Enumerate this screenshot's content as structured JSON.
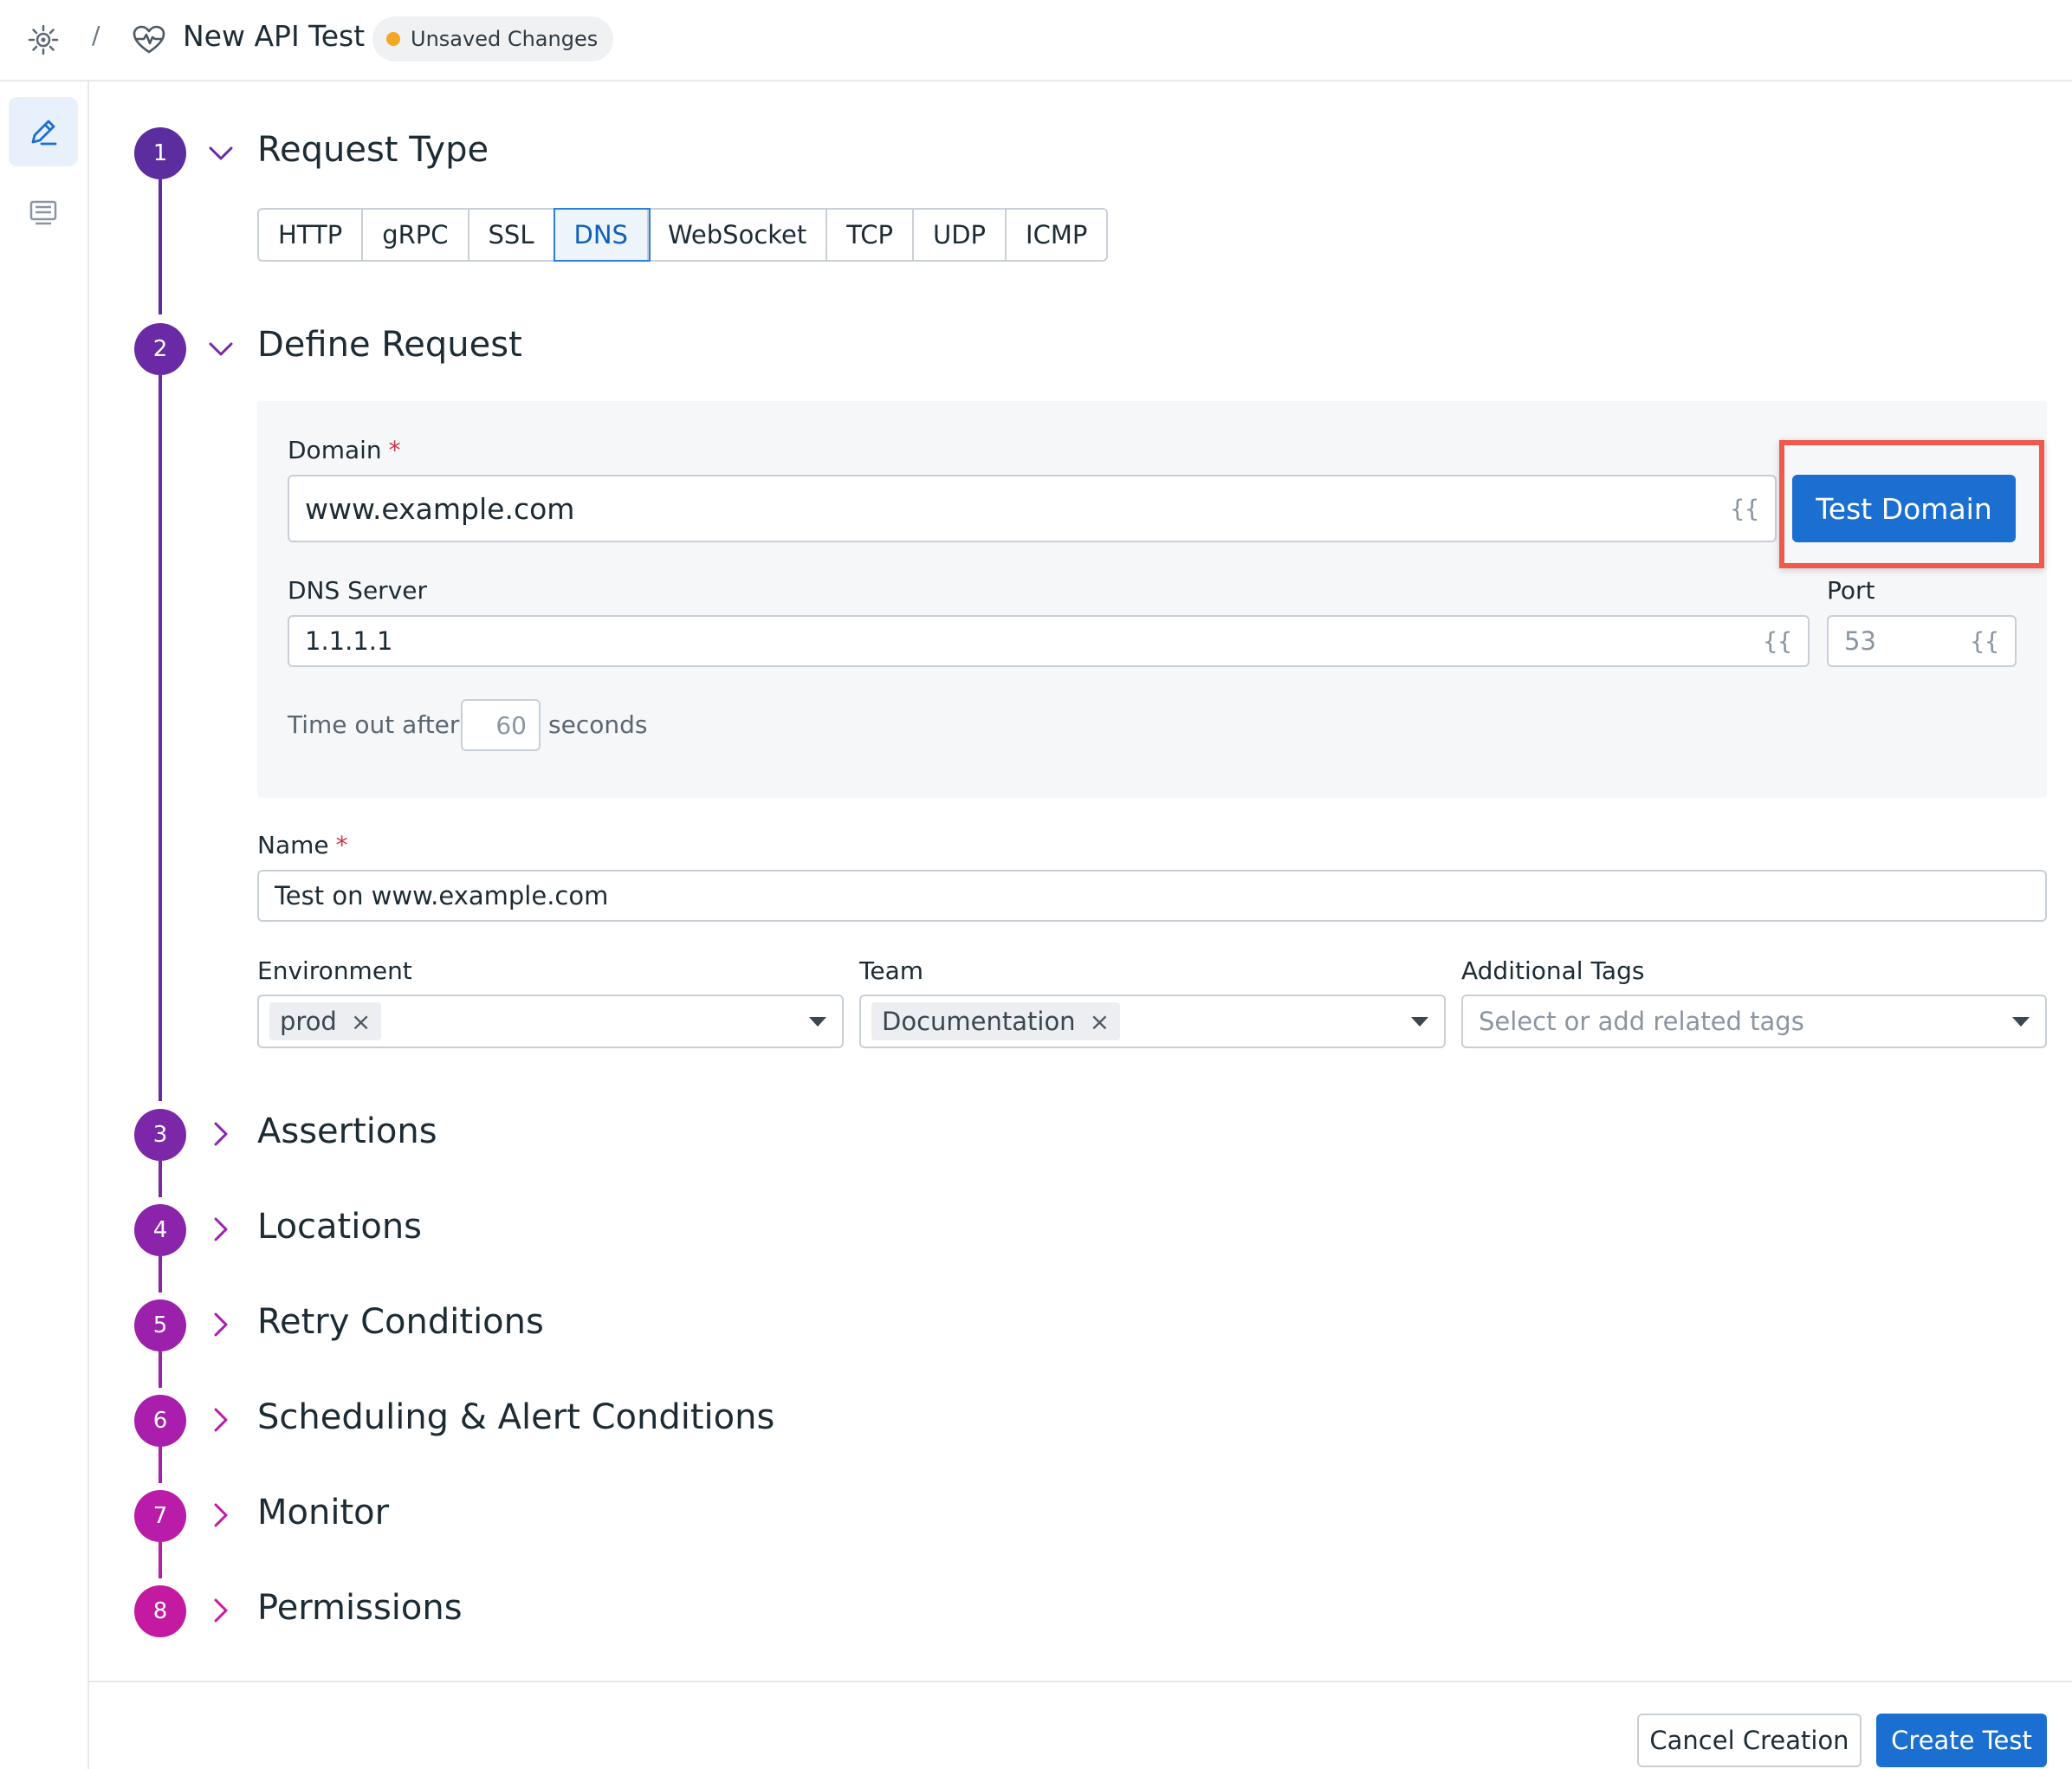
{
  "header": {
    "logo_icon": "datadog-logo-icon",
    "separator": "/",
    "test_icon": "heartbeat-icon",
    "title": "New API Test",
    "status_badge": "Unsaved Changes",
    "status_color": "#f5a623"
  },
  "rail": {
    "items": [
      {
        "icon": "pencil-icon",
        "active": true
      },
      {
        "icon": "list-icon",
        "active": false
      }
    ]
  },
  "steps": [
    {
      "number": "1",
      "title": "Request Type",
      "expanded": true
    },
    {
      "number": "2",
      "title": "Define Request",
      "expanded": true
    },
    {
      "number": "3",
      "title": "Assertions",
      "expanded": false
    },
    {
      "number": "4",
      "title": "Locations",
      "expanded": false
    },
    {
      "number": "5",
      "title": "Retry Conditions",
      "expanded": false
    },
    {
      "number": "6",
      "title": "Scheduling & Alert Conditions",
      "expanded": false
    },
    {
      "number": "7",
      "title": "Monitor",
      "expanded": false
    },
    {
      "number": "8",
      "title": "Permissions",
      "expanded": false
    }
  ],
  "request_types": {
    "options": [
      "HTTP",
      "gRPC",
      "SSL",
      "DNS",
      "WebSocket",
      "TCP",
      "UDP",
      "ICMP"
    ],
    "selected": "DNS"
  },
  "define_request": {
    "domain_label": "Domain",
    "required_mark": "*",
    "domain_value": "www.example.com",
    "variable_icon_text": "{{",
    "test_button": "Test Domain",
    "dns_server_label": "DNS Server",
    "dns_server_value": "1.1.1.1",
    "port_label": "Port",
    "port_placeholder": "53",
    "timeout_prefix": "Time out after",
    "timeout_value": "60",
    "timeout_suffix": "seconds"
  },
  "details": {
    "name_label": "Name",
    "name_value": "Test on www.example.com",
    "environment_label": "Environment",
    "environment_value": "prod",
    "team_label": "Team",
    "team_value": "Documentation",
    "tags_label": "Additional Tags",
    "tags_placeholder": "Select or add related tags",
    "remove_glyph": "×"
  },
  "footer": {
    "cancel": "Cancel Creation",
    "create": "Create Test"
  },
  "colors": {
    "primary": "#1a6fd1",
    "highlight": "#ef5a4d",
    "step_gradient": [
      "#5b2d9e",
      "#6a2aa5",
      "#7b27a8",
      "#8b24ab",
      "#9b21ad",
      "#a91eac",
      "#b81ca8",
      "#c41aa2"
    ]
  }
}
